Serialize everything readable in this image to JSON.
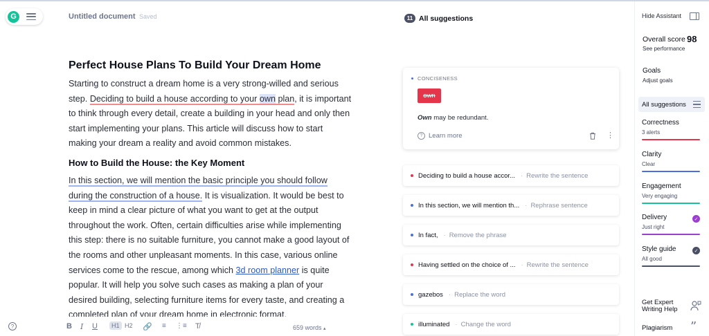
{
  "editor": {
    "doc_title": "Untitled document",
    "save_status": "Saved",
    "heading": "Perfect House Plans To Build Your Dream Home",
    "p1_a": "Starting to construct a dream home is a very strong-willed and serious step. ",
    "p1_flag": "Deciding to build a house according to your ",
    "p1_own": "own",
    "p1_plan": " plan",
    "p1_b": ", it is important to think through every detail, create a building in your head and only then start implementing your plans. This article will discuss how to start making your dream a reality and avoid common mistakes.",
    "subheading": "How to Build the House: the Key Moment",
    "p2_flag": "In this section, we will mention the basic principle you should follow during the construction of a house.",
    "p2_a": " It is visualization. It would be best to keep in mind a clear picture of what you want to get at the output throughout the work. Often, certain difficulties arise while implementing this step: there is no suitable furniture, you cannot make a good layout of the rooms and other unpleasant moments. In this case, various online services come to the rescue, among which ",
    "p2_link": "3d room planner",
    "p2_b": " is quite popular. It will help you solve such cases as making a plan of your desired building, selecting furniture items for every taste, and creating a completed plan of your dream home in electronic format.",
    "toolbar": {
      "bold": "B",
      "italic": "I",
      "underline": "U",
      "h1": "H1",
      "h2": "H2",
      "link_icon": "link-icon",
      "ol_icon": "ordered-list-icon",
      "ul_icon": "bullet-list-icon",
      "clear_icon": "clear-format-icon"
    },
    "word_count": "659 words"
  },
  "suggestions": {
    "count": "11",
    "title": "All suggestions",
    "main": {
      "category": "CONCISENESS",
      "chip": "own",
      "message_bold": "Own",
      "message_rest": " may be redundant.",
      "learn_more": "Learn more"
    },
    "items": [
      {
        "text": "Deciding to build a house accor...",
        "action": "Rewrite the sentence",
        "color": "#e5354a"
      },
      {
        "text": "In this section, we will mention th...",
        "action": "Rephrase sentence",
        "color": "#4a6ee0"
      },
      {
        "text": "In fact,",
        "action": "Remove the phrase",
        "color": "#4a6ee0"
      },
      {
        "text": "Having settled on the choice of ...",
        "action": "Rewrite the sentence",
        "color": "#e5354a"
      },
      {
        "text": "gazebos",
        "action": "Replace the word",
        "color": "#4a6ee0"
      },
      {
        "text": "illuminated",
        "action": "Change the word",
        "color": "#15c39a"
      }
    ]
  },
  "assistant": {
    "hide": "Hide Assistant",
    "overall_label": "Overall score",
    "overall_score": "98",
    "see_performance": "See performance",
    "goals": "Goals",
    "adjust_goals": "Adjust goals",
    "all_suggestions": "All suggestions",
    "categories": [
      {
        "name": "Correctness",
        "sub": "3 alerts",
        "color": "#e5354a"
      },
      {
        "name": "Clarity",
        "sub": "Clear",
        "color": "#4a6ee0"
      },
      {
        "name": "Engagement",
        "sub": "Very engaging",
        "color": "#15c39a"
      },
      {
        "name": "Delivery",
        "sub": "Just right",
        "color": "#9b3fd1"
      },
      {
        "name": "Style guide",
        "sub": "All good",
        "color": "#4a4f63"
      }
    ],
    "expert_line1": "Get Expert",
    "expert_line2": "Writing Help",
    "plagiarism": "Plagiarism"
  }
}
